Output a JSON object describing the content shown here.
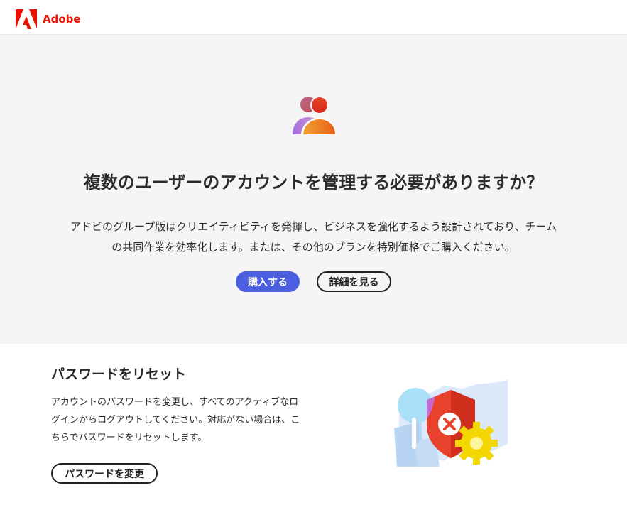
{
  "header": {
    "brand_name": "Adobe",
    "logo_icon": "adobe-logo-icon",
    "brand_color": "#eb1000"
  },
  "hero": {
    "icon": "users-icon",
    "title": "複数のユーザーのアカウントを管理する必要がありますか？",
    "description_line1": "アドビのグループ版はクリエイティビティを発揮し、ビジネスを強化するよう設計されており、チーム",
    "description_line2": "の共同作業を効率化します。または、その他のプランを特別価格でご購入ください。",
    "buy_label": "購入する",
    "details_label": "詳細を見る",
    "background": "#f5f5f5",
    "accent": "#4b5fe0"
  },
  "reset": {
    "title": "パスワードをリセット",
    "description": "アカウントのパスワードを変更し、すべてのアクティブなログインからログアウトしてください。対応がない場合は、こちらでパスワードをリセットします。",
    "button_label": "パスワードを変更",
    "illustration": "security-shield-illustration"
  }
}
